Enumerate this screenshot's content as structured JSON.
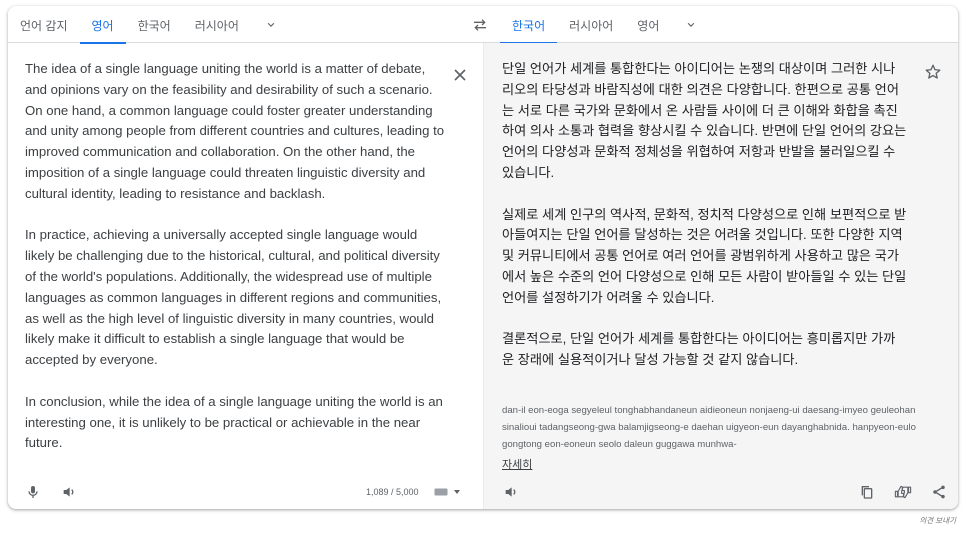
{
  "source_languages": {
    "tabs": [
      {
        "label": "언어 감지",
        "active": false
      },
      {
        "label": "영어",
        "active": true
      },
      {
        "label": "한국어",
        "active": false
      },
      {
        "label": "러시아어",
        "active": false
      }
    ]
  },
  "target_languages": {
    "tabs": [
      {
        "label": "한국어",
        "active": true
      },
      {
        "label": "러시아어",
        "active": false
      },
      {
        "label": "영어",
        "active": false
      }
    ]
  },
  "source": {
    "paragraphs": [
      "The idea of a single language uniting the world is a matter of debate, and opinions vary on the feasibility and desirability of such a scenario. On one hand, a common language could foster greater understanding and unity among people from different countries and cultures, leading to improved communication and collaboration. On the other hand, the imposition of a single language could threaten linguistic diversity and cultural identity, leading to resistance and backlash.",
      "In practice, achieving a universally accepted single language would likely be challenging due to the historical, cultural, and political diversity of the world's populations. Additionally, the widespread use of multiple languages as common languages in different regions and communities, as well as the high level of linguistic diversity in many countries, would likely make it difficult to establish a single language that would be accepted by everyone.",
      "In conclusion, while the idea of a single language uniting the world is an interesting one, it is unlikely to be practical or achievable in the near future."
    ],
    "char_count": "1,089 / 5,000"
  },
  "target": {
    "paragraphs": [
      "단일 언어가 세계를 통합한다는 아이디어는 논쟁의 대상이며 그러한 시나리오의 타당성과 바람직성에 대한 의견은 다양합니다. 한편으로 공통 언어는 서로 다른 국가와 문화에서 온 사람들 사이에 더 큰 이해와 화합을 촉진하여 의사 소통과 협력을 향상시킬 수 있습니다. 반면에 단일 언어의 강요는 언어의 다양성과 문화적 정체성을 위협하여 저항과 반발을 불러일으킬 수 있습니다.",
      "실제로 세계 인구의 역사적, 문화적, 정치적 다양성으로 인해 보편적으로 받아들여지는 단일 언어를 달성하는 것은 어려울 것입니다. 또한 다양한 지역 및 커뮤니티에서 공통 언어로 여러 언어를 광범위하게 사용하고 많은 국가에서 높은 수준의 언어 다양성으로 인해 모든 사람이 받아들일 수 있는 단일 언어를 설정하기가 어려울 수 있습니다.",
      "결론적으로, 단일 언어가 세계를 통합한다는 아이디어는 흥미롭지만 가까운 장래에 실용적이거나 달성 가능할 것 같지 않습니다."
    ],
    "romanization": "dan-il eon-eoga segyeleul tonghabhandaneun aidieoneun nonjaeng-ui daesang-imyeo geuleohan sinalioui tadangseong-gwa balamjigseong-e daehan uigyeon-eun dayanghabnida. hanpyeon-eulo gongtong eon-eoneun seolo daleun guggawa munhwa-",
    "more_label": "자세히"
  },
  "feedback_label": "의견 보내기",
  "icons": {
    "more_languages": "chevron-down-icon",
    "swap": "swap-icon",
    "clear": "close-icon",
    "mic": "mic-icon",
    "listen": "speaker-icon",
    "keyboard": "keyboard-icon",
    "save": "star-icon",
    "copy": "copy-icon",
    "rate": "thumbs-icon",
    "share": "share-icon"
  },
  "colors": {
    "accent": "#1a73e8",
    "text": "#3c4043",
    "muted": "#5f6368",
    "target_bg": "#f5f5f5"
  }
}
